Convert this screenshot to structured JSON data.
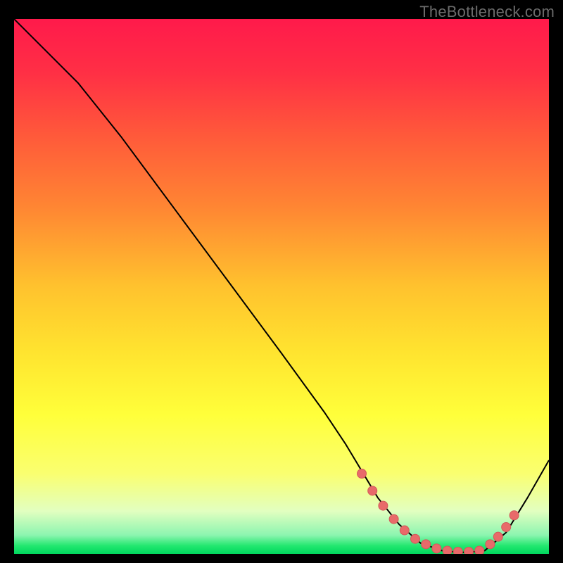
{
  "attribution": "TheBottleneck.com",
  "colors": {
    "background": "#000000",
    "gradient_stops": [
      {
        "offset": 0.0,
        "color": "#ff1a4b"
      },
      {
        "offset": 0.1,
        "color": "#ff2f45"
      },
      {
        "offset": 0.22,
        "color": "#ff5a3a"
      },
      {
        "offset": 0.35,
        "color": "#ff8533"
      },
      {
        "offset": 0.5,
        "color": "#ffc22e"
      },
      {
        "offset": 0.62,
        "color": "#ffe32f"
      },
      {
        "offset": 0.74,
        "color": "#ffff3a"
      },
      {
        "offset": 0.85,
        "color": "#faff70"
      },
      {
        "offset": 0.92,
        "color": "#e2ffc0"
      },
      {
        "offset": 0.965,
        "color": "#8cf5b0"
      },
      {
        "offset": 0.985,
        "color": "#22e76f"
      },
      {
        "offset": 1.0,
        "color": "#00d85e"
      }
    ],
    "line": "#000000",
    "marker_fill": "#e86a6a",
    "marker_stroke": "#d25a5a"
  },
  "chart_data": {
    "type": "line",
    "title": "",
    "xlabel": "",
    "ylabel": "",
    "xlim": [
      0,
      100
    ],
    "ylim": [
      0,
      100
    ],
    "series": [
      {
        "name": "curve",
        "x": [
          0,
          6,
          12,
          20,
          30,
          40,
          50,
          58,
          62,
          65,
          68,
          72,
          76,
          80,
          83,
          85,
          88,
          92,
          96,
          100
        ],
        "y": [
          100,
          94,
          88,
          78,
          64.5,
          51,
          37.5,
          26.5,
          20.5,
          15.5,
          10.5,
          5.5,
          2.0,
          0.6,
          0.3,
          0.3,
          0.6,
          4.0,
          10.5,
          17.5
        ]
      }
    ],
    "markers": {
      "name": "highlight-dots",
      "x": [
        65,
        67,
        69,
        71,
        73,
        75,
        77,
        79,
        81,
        83,
        85,
        87,
        89,
        90.5,
        92,
        93.5
      ],
      "y": [
        15.0,
        11.8,
        9.0,
        6.5,
        4.4,
        2.8,
        1.8,
        1.0,
        0.6,
        0.4,
        0.4,
        0.6,
        1.8,
        3.2,
        5.0,
        7.2
      ]
    }
  }
}
